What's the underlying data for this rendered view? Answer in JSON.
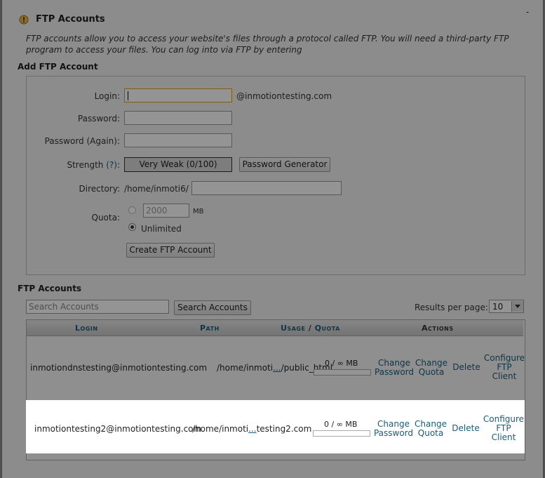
{
  "header": {
    "title": "FTP Accounts",
    "minimize": "-"
  },
  "description": "FTP accounts allow you to access your website's files through a protocol called FTP. You will need a third-party FTP program to access your files. You can log into via FTP by entering",
  "add_form": {
    "section_title": "Add FTP Account",
    "login_label": "Login:",
    "login_value": "",
    "domain_suffix": "@inmotiontesting.com",
    "password_label": "Password:",
    "password_again_label": "Password (Again):",
    "strength_label": "Strength",
    "strength_help": "(?)",
    "strength_colon": ":",
    "strength_value": "Very Weak (0/100)",
    "password_generator": "Password Generator",
    "directory_label": "Directory:",
    "directory_prefix": "/home/inmoti6/",
    "directory_value": "",
    "quota_label": "Quota:",
    "quota_value": "2000",
    "quota_unit": "MB",
    "unlimited_label": "Unlimited",
    "quota_mode": "unlimited",
    "create_button": "Create FTP Account"
  },
  "accounts": {
    "section_title": "FTP Accounts",
    "search_placeholder": "Search Accounts",
    "search_button": "Search Accounts",
    "results_label": "Results per page:",
    "results_value": "10",
    "columns": {
      "login": "Login",
      "path": "Path",
      "usage": "Usage",
      "slash": "/",
      "quota": "Quota",
      "actions": "Actions"
    },
    "rows": [
      {
        "login": "inmotiondnstesting@inmotiontesting.com",
        "path_start": "/home/inmoti",
        "path_ellipsis": "...",
        "path_end": "/public_html",
        "usage": "0 / ∞ MB",
        "usage_fraction": 0,
        "change_password": [
          "Change",
          "Password"
        ],
        "change_quota": [
          "Change",
          "Quota"
        ],
        "delete": "Delete",
        "configure": [
          "Configure",
          "FTP",
          "Client"
        ]
      },
      {
        "login": "inmotiontesting2@inmotiontesting.com",
        "path_start": "/home/inmoti",
        "path_ellipsis": "...",
        "path_end": "testing2.com",
        "usage": "0 / ∞ MB",
        "usage_fraction": 0,
        "change_password": [
          "Change",
          "Password"
        ],
        "change_quota": [
          "Change",
          "Quota"
        ],
        "delete": "Delete",
        "configure": [
          "Configure",
          "FTP",
          "Client"
        ]
      }
    ]
  },
  "colors": {
    "link": "#1b5c7a",
    "overlay": "rgba(0,0,0,0.42)",
    "highlight_row": "#ffffff"
  },
  "icons": {
    "title_icon": "ftp-warning-icon",
    "dropdown": "chevron-down-icon"
  }
}
